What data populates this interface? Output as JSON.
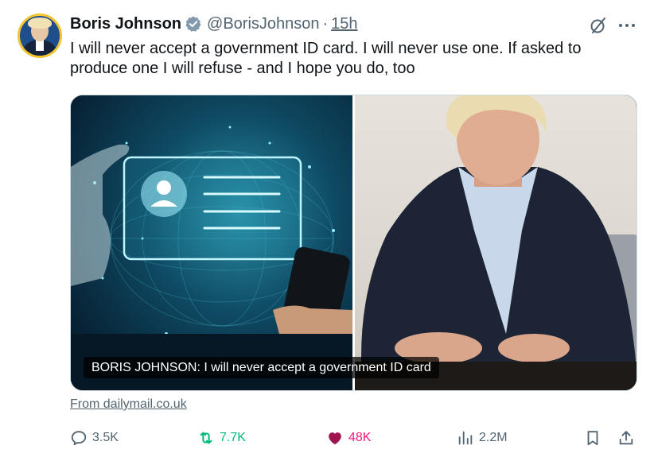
{
  "tweet": {
    "display_name": "Boris Johnson",
    "handle": "@BorisJohnson",
    "separator": "·",
    "time": "15h",
    "text": "I will never accept a government ID card. I will never use one. If asked to produce one I will refuse - and I hope you do, too"
  },
  "media": {
    "caption": "BORIS JOHNSON: I will never accept a government ID card"
  },
  "link_source": "From dailymail.co.uk",
  "actions": {
    "replies": "3.5K",
    "retweets": "7.7K",
    "likes": "48K",
    "views": "2.2M"
  },
  "colors": {
    "verified": "#829aab",
    "retweet": "#00ba7c",
    "like": "#f91880",
    "muted": "#536471",
    "avatar_ring": "#f4c430"
  },
  "icons": [
    "verified-badge-icon",
    "grok-icon",
    "more-icon",
    "reply-icon",
    "retweet-icon",
    "heart-icon",
    "views-icon",
    "bookmark-icon",
    "share-icon"
  ]
}
